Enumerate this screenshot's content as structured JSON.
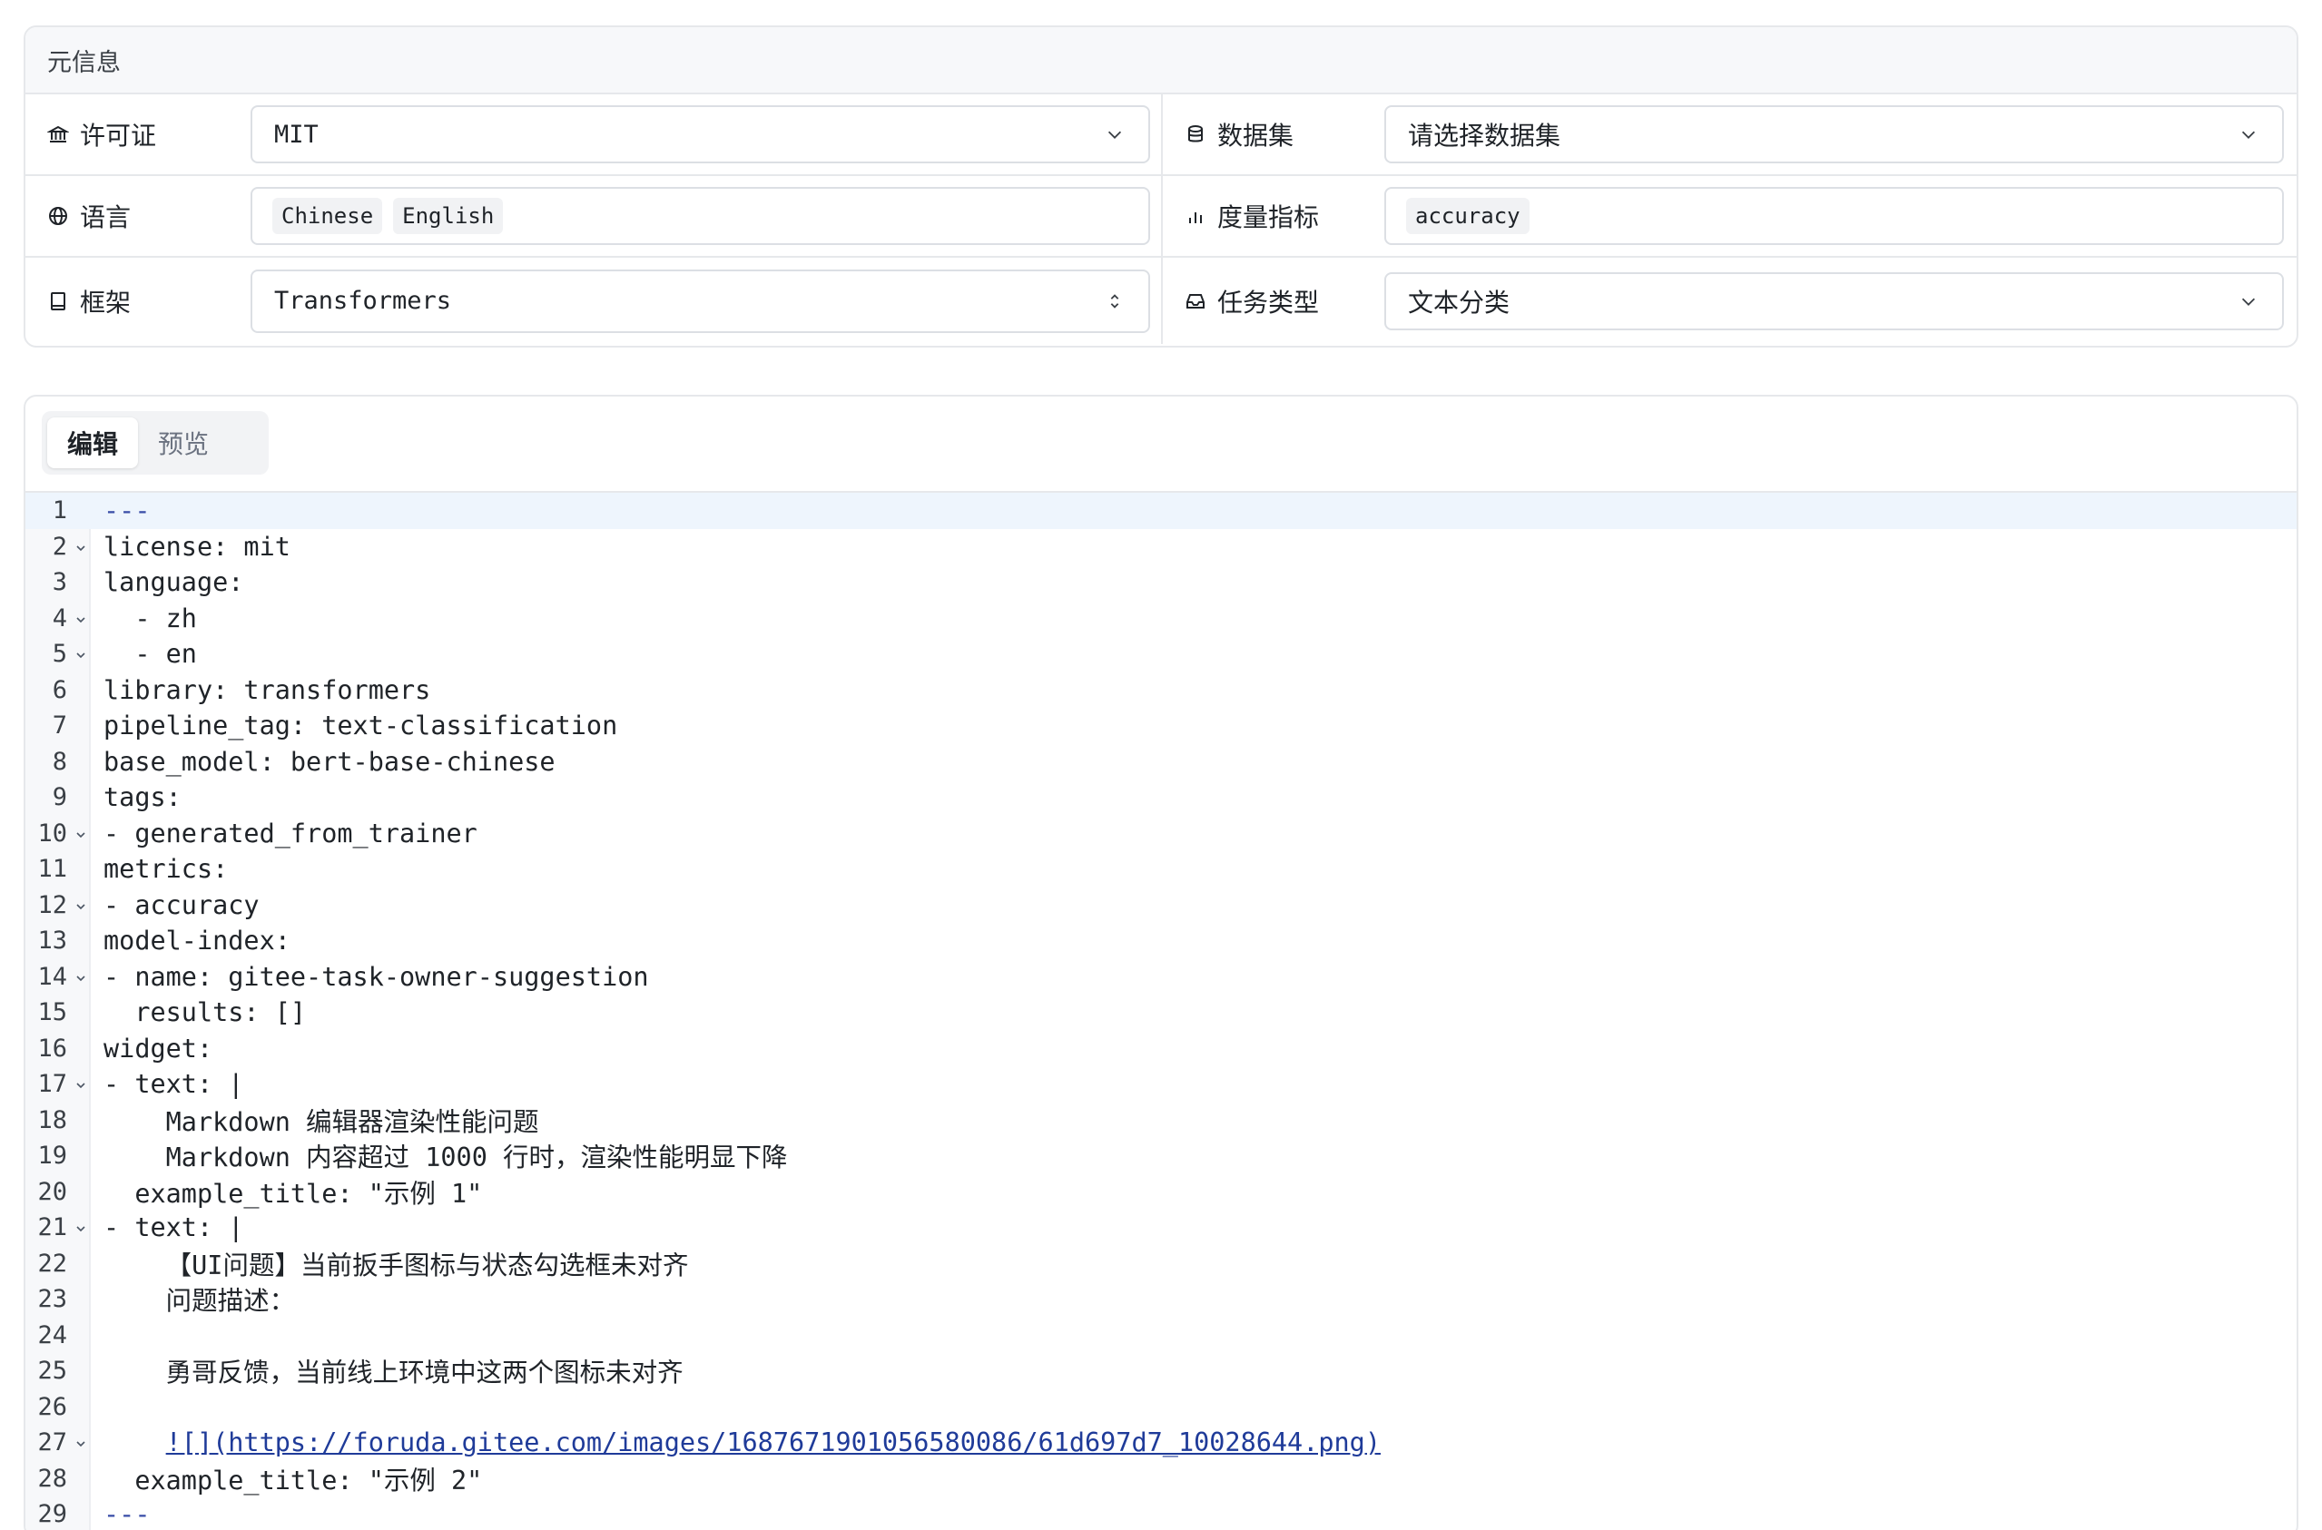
{
  "meta": {
    "title": "元信息",
    "license": {
      "label": "许可证",
      "value": "MIT",
      "icon": "bank-icon"
    },
    "dataset": {
      "label": "数据集",
      "value": "请选择数据集",
      "icon": "database-icon"
    },
    "language": {
      "label": "语言",
      "tags": [
        "Chinese",
        "English"
      ],
      "icon": "globe-icon"
    },
    "metrics": {
      "label": "度量指标",
      "tags": [
        "accuracy"
      ],
      "icon": "bar-chart-icon"
    },
    "framework": {
      "label": "框架",
      "value": "Transformers",
      "icon": "book-icon"
    },
    "task": {
      "label": "任务类型",
      "value": "文本分类",
      "icon": "inbox-icon"
    }
  },
  "editor": {
    "tabs": [
      "编辑",
      "预览"
    ],
    "active_tab": "编辑",
    "lines": [
      {
        "n": "1",
        "text": "---",
        "fold": false
      },
      {
        "n": "2",
        "text": "license: mit",
        "fold": true
      },
      {
        "n": "3",
        "text": "language:",
        "fold": false
      },
      {
        "n": "4",
        "text": "  - zh",
        "fold": true
      },
      {
        "n": "5",
        "text": "  - en",
        "fold": true
      },
      {
        "n": "6",
        "text": "library: transformers",
        "fold": false
      },
      {
        "n": "7",
        "text": "pipeline_tag: text-classification",
        "fold": false
      },
      {
        "n": "8",
        "text": "base_model: bert-base-chinese",
        "fold": false
      },
      {
        "n": "9",
        "text": "tags:",
        "fold": false
      },
      {
        "n": "10",
        "text": "- generated_from_trainer",
        "fold": true
      },
      {
        "n": "11",
        "text": "metrics:",
        "fold": false
      },
      {
        "n": "12",
        "text": "- accuracy",
        "fold": true
      },
      {
        "n": "13",
        "text": "model-index:",
        "fold": false
      },
      {
        "n": "14",
        "text": "- name: gitee-task-owner-suggestion",
        "fold": true
      },
      {
        "n": "15",
        "text": "  results: []",
        "fold": false
      },
      {
        "n": "16",
        "text": "widget:",
        "fold": false
      },
      {
        "n": "17",
        "text": "- text: |",
        "fold": true
      },
      {
        "n": "18",
        "text": "    Markdown 编辑器渲染性能问题",
        "fold": false
      },
      {
        "n": "19",
        "text": "    Markdown 内容超过 1000 行时，渲染性能明显下降",
        "fold": false
      },
      {
        "n": "20",
        "text": "  example_title: \"示例 1\"",
        "fold": false
      },
      {
        "n": "21",
        "text": "- text: |",
        "fold": true
      },
      {
        "n": "22",
        "text": "    【UI问题】当前扳手图标与状态勾选框未对齐",
        "fold": false
      },
      {
        "n": "23",
        "text": "    问题描述：",
        "fold": false
      },
      {
        "n": "24",
        "text": "",
        "fold": false
      },
      {
        "n": "25",
        "text": "    勇哥反馈，当前线上环境中这两个图标未对齐",
        "fold": false
      },
      {
        "n": "26",
        "text": "",
        "fold": false
      },
      {
        "n": "27",
        "text": "    ![](https://foruda.gitee.com/images/1687671901056580086/61d697d7_10028644.png)",
        "fold": true
      },
      {
        "n": "28",
        "text": "  example_title: \"示例 2\"",
        "fold": false
      },
      {
        "n": "29",
        "text": "---",
        "fold": false
      }
    ]
  },
  "colors": {
    "border": "#e6e8eb",
    "header_bg": "#f7f8fa",
    "active_line": "#eef5fd",
    "link": "#1f3b99"
  }
}
